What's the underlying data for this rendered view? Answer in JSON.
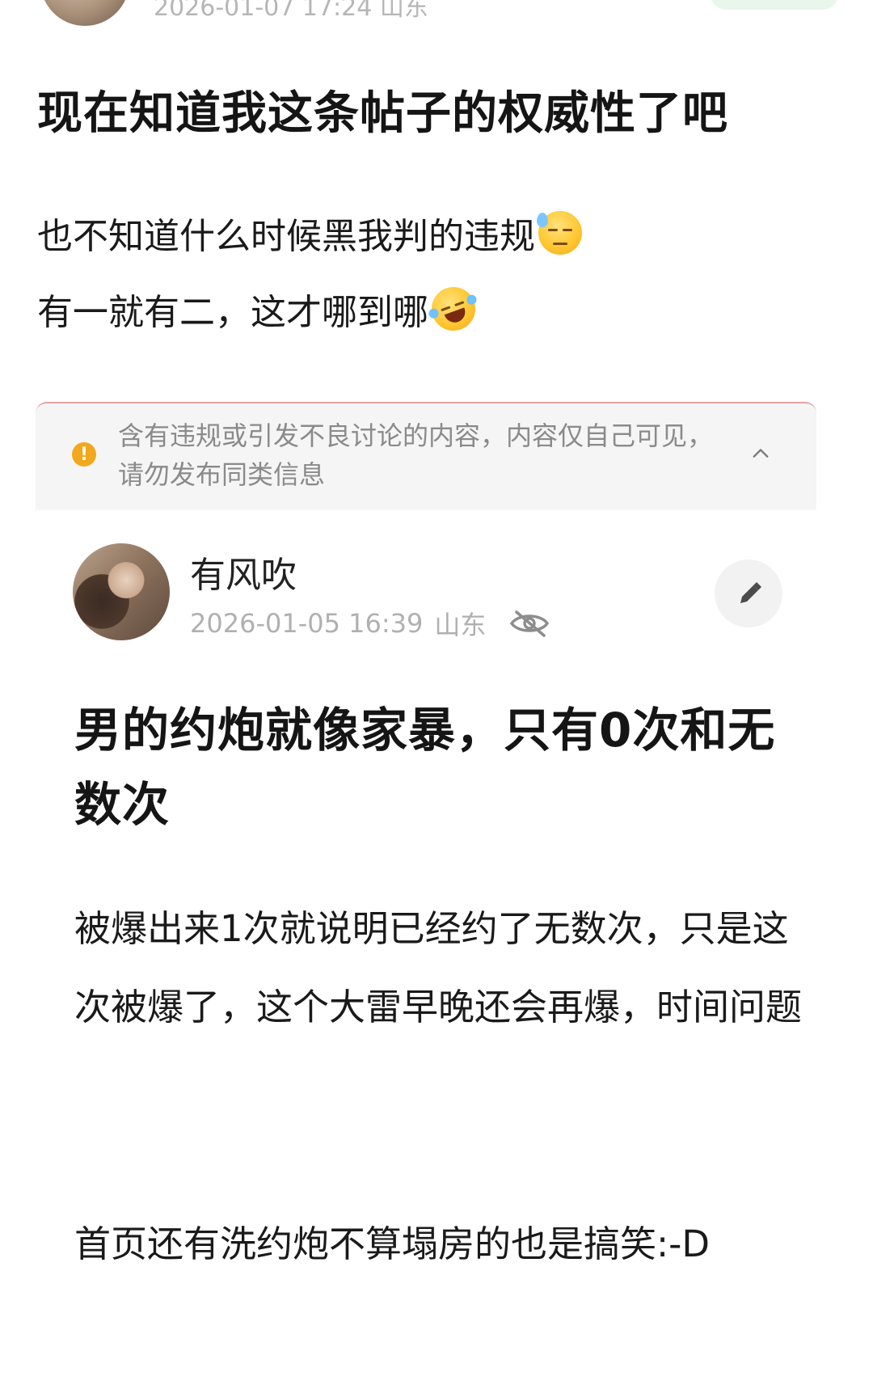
{
  "post_top": {
    "meta": "2026-01-07 17:24  山东",
    "title": "现在知道我这条帖子的权威性了吧",
    "line1": "也不知道什么时候黑我判的违规",
    "line1_emoji": "sweat-face-emoji",
    "line2": "有一就有二，这才哪到哪",
    "line2_emoji": "rolling-laugh-emoji"
  },
  "notice": {
    "text": "含有违规或引发不良讨论的内容，内容仅自己可见，请勿发布同类信息",
    "icon": "warning-icon",
    "icon_color": "#f2a81d"
  },
  "post_main": {
    "username": "有风吹",
    "datetime": "2026-01-05 16:39",
    "location": "山东",
    "visibility_icon": "eye-hidden-icon",
    "edit_icon": "pencil-icon",
    "title": "男的约炮就像家暴，只有0次和无数次",
    "paragraph1": "被爆出来1次就说明已经约了无数次，只是这次被爆了，这个大雷早晚还会再爆，时间问题",
    "paragraph2": "首页还有洗约炮不算塌房的也是搞笑:-D"
  }
}
